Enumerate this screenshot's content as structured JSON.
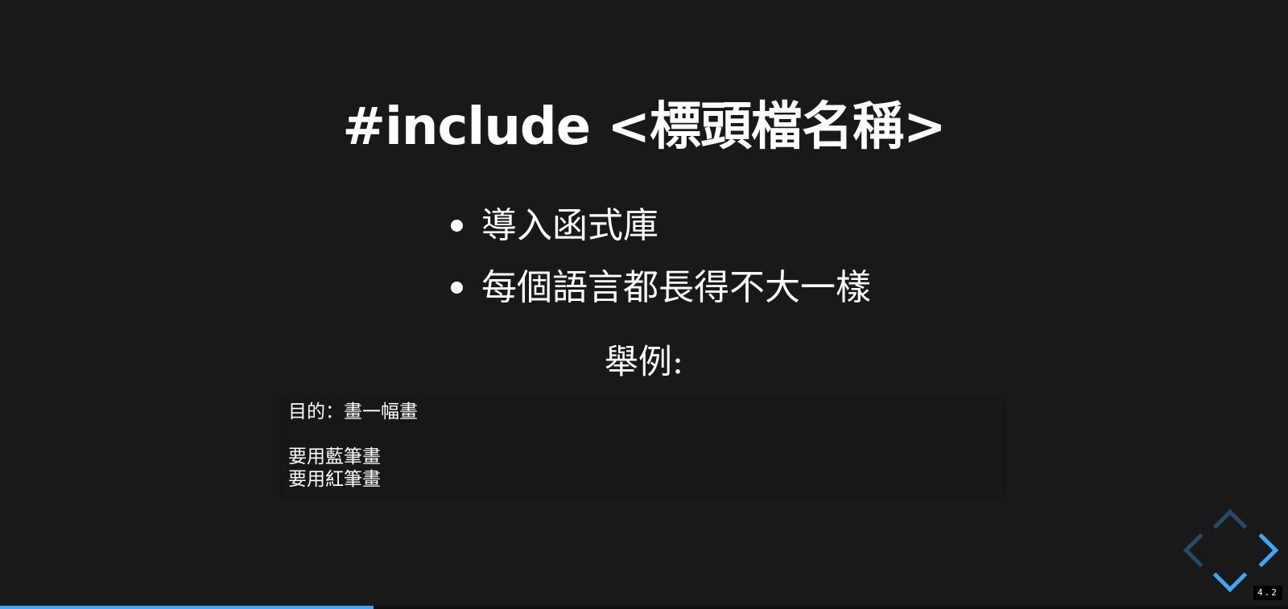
{
  "slide": {
    "title": "#include <標頭檔名稱>",
    "bullets": [
      "導入函式庫",
      "每個語言都長得不大一樣"
    ],
    "example_label": "舉例:",
    "code_lines": [
      "目的：畫一幅畫",
      "",
      "要用藍筆畫",
      "要用紅筆畫"
    ]
  },
  "slide_number": "4.2",
  "progress": 0.29,
  "colors": {
    "background": "#191919",
    "text": "#ffffff",
    "accent": "#42a5f5"
  },
  "controls": {
    "up_icon": "chevron-up-icon",
    "down_icon": "chevron-down-icon",
    "left_icon": "chevron-left-icon",
    "right_icon": "chevron-right-icon"
  }
}
